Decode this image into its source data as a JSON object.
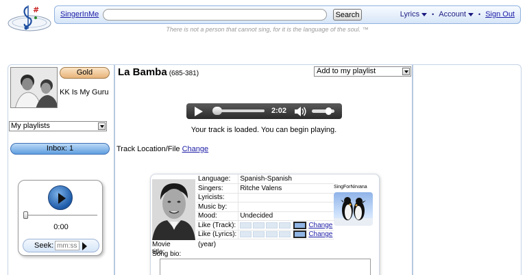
{
  "header": {
    "site_link": "SingerInMe",
    "search_placeholder": "",
    "search_button": "Search",
    "nav": {
      "lyrics": "Lyrics",
      "account": "Account",
      "signout": "Sign Out"
    },
    "tagline": "There is not a person that cannot sing, for it is the language of the soul. ™"
  },
  "sidebar": {
    "membership": "Gold",
    "username": "KK Is My Guru",
    "playlists_select": "My playlists",
    "inbox": "Inbox: 1",
    "mini_player": {
      "time": "0:00",
      "seek_label": "Seek:",
      "seek_placeholder": "mm:ss",
      "position_fraction": 0
    }
  },
  "song": {
    "title": "La Bamba",
    "id": "(685-381)",
    "add_to_playlist": "Add to my playlist",
    "player": {
      "time": "2:02",
      "progress_fraction": 0.05,
      "volume_fraction": 0.85
    },
    "loaded_message": "Your track is loaded. You can begin playing.",
    "track_location_label": "Track Location/File",
    "track_location_link": "Change"
  },
  "info": {
    "rows": [
      {
        "label": "Language:",
        "value": "Spanish-Spanish"
      },
      {
        "label": "Singers:",
        "value": "Ritche Valens"
      },
      {
        "label": "Lyricists:",
        "value": ""
      },
      {
        "label": "Music by:",
        "value": ""
      },
      {
        "label": "Mood:",
        "value": "Undecided"
      }
    ],
    "like_track_label": "Like (Track):",
    "like_lyrics_label": "Like (Lyrics):",
    "like_track_rating": 5,
    "like_lyrics_rating": 5,
    "change_link": "Change",
    "brand": "SingForNirvana",
    "movie_label": "Movie title:",
    "movie_value": "(year)",
    "bio_label": "Song bio:"
  },
  "colors": {
    "accent_blue": "#5f9ee0",
    "gold": "#e7b47a",
    "link": "#1a1aa6",
    "panel_border": "#b6c8e0"
  }
}
